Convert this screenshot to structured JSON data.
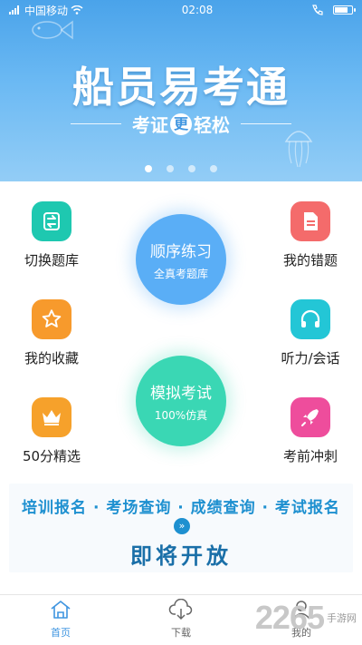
{
  "status_bar": {
    "carrier": "中国移动",
    "time": "02:08"
  },
  "banner": {
    "title": "船员易考通",
    "subtitle_before": "考证",
    "subtitle_highlight": "更",
    "subtitle_after": "轻松",
    "slides": 4,
    "active_slide": 0
  },
  "menu": {
    "left": [
      {
        "label": "切换题库",
        "icon": "switch-bank-icon",
        "color": "#1ec8b0"
      },
      {
        "label": "我的收藏",
        "icon": "star-icon",
        "color": "#f79a2c"
      },
      {
        "label": "50分精选",
        "icon": "crown-icon",
        "color": "#f6a12b"
      }
    ],
    "right": [
      {
        "label": "我的错题",
        "icon": "document-icon",
        "color": "#f46b6b"
      },
      {
        "label": "听力/会话",
        "icon": "headphones-icon",
        "color": "#23c6d6"
      },
      {
        "label": "考前冲刺",
        "icon": "rocket-icon",
        "color": "#ee4d9c"
      }
    ],
    "sequential": {
      "title": "顺序练习",
      "subtitle": "全真考题库",
      "color": "#5aaef6"
    },
    "mock": {
      "title": "模拟考试",
      "subtitle": "100%仿真",
      "color": "#3ad7b4"
    }
  },
  "notice": {
    "services": "培训报名 · 考场查询 · 成绩查询 · 考试报名",
    "coming_soon": "即将开放"
  },
  "tabs": [
    {
      "label": "首页",
      "icon": "home-icon",
      "active": true
    },
    {
      "label": "下载",
      "icon": "download-icon",
      "active": false
    },
    {
      "label": "我的",
      "icon": "user-icon",
      "active": false
    }
  ],
  "watermark": {
    "number": "2265",
    "text": "手游网"
  },
  "colors": {
    "accent": "#3f95e0",
    "active_tab": "#3f95e0",
    "inactive_tab": "#666666"
  }
}
